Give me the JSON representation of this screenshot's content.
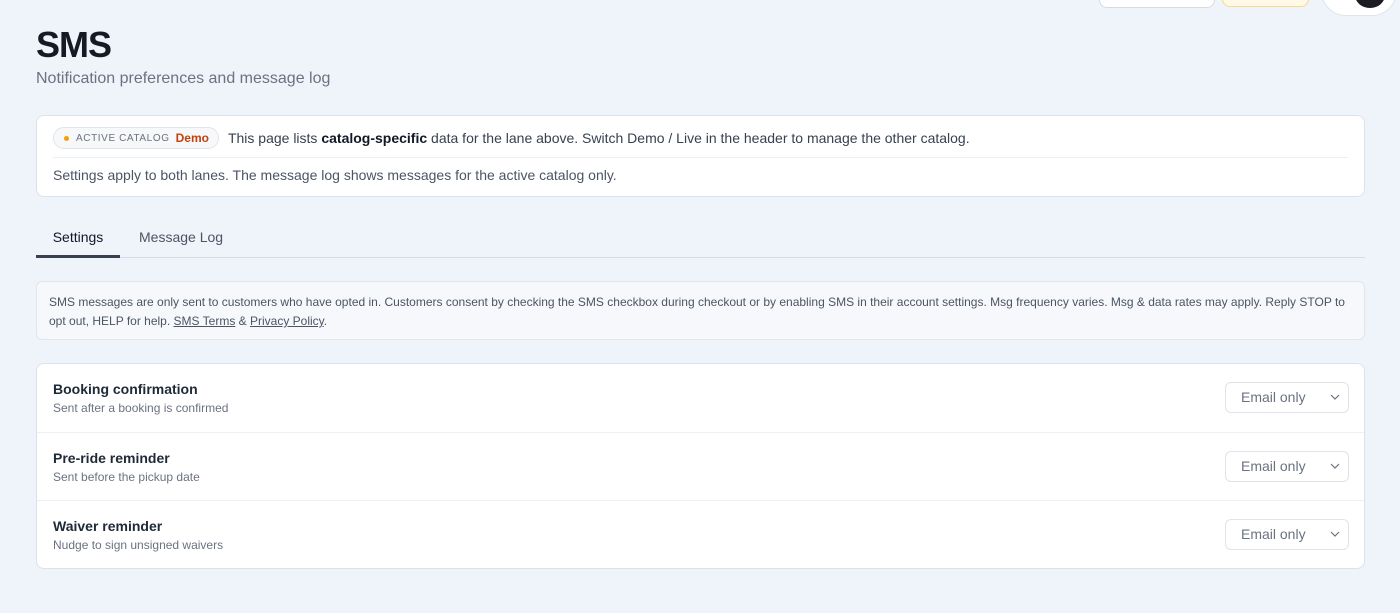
{
  "header": {
    "title": "SMS",
    "subtitle": "Notification preferences and message log"
  },
  "catalog": {
    "badge_label": "ACTIVE CATALOG",
    "badge_value": "Demo",
    "info_prefix": "This page lists ",
    "info_bold": "catalog-specific",
    "info_suffix": " data for the lane above. Switch Demo / Live in the header to manage the other catalog.",
    "note": "Settings apply to both lanes. The message log shows messages for the active catalog only.",
    "dot_color": "#f59e0b"
  },
  "tabs": [
    {
      "label": "Settings",
      "active": true
    },
    {
      "label": "Message Log",
      "active": false
    }
  ],
  "consent": {
    "text": "SMS messages are only sent to customers who have opted in. Customers consent by checking the SMS checkbox during checkout or by enabling SMS in their account settings. Msg frequency varies. Msg & data rates may apply. Reply STOP to opt out, HELP for help. ",
    "terms_link": "SMS Terms",
    "separator": " & ",
    "privacy_link": "Privacy Policy",
    "end": "."
  },
  "settings": [
    {
      "title": "Booking confirmation",
      "description": "Sent after a booking is confirmed",
      "value": "Email only"
    },
    {
      "title": "Pre-ride reminder",
      "description": "Sent before the pickup date",
      "value": "Email only"
    },
    {
      "title": "Waiver reminder",
      "description": "Nudge to sign unsigned waivers",
      "value": "Email only"
    }
  ]
}
